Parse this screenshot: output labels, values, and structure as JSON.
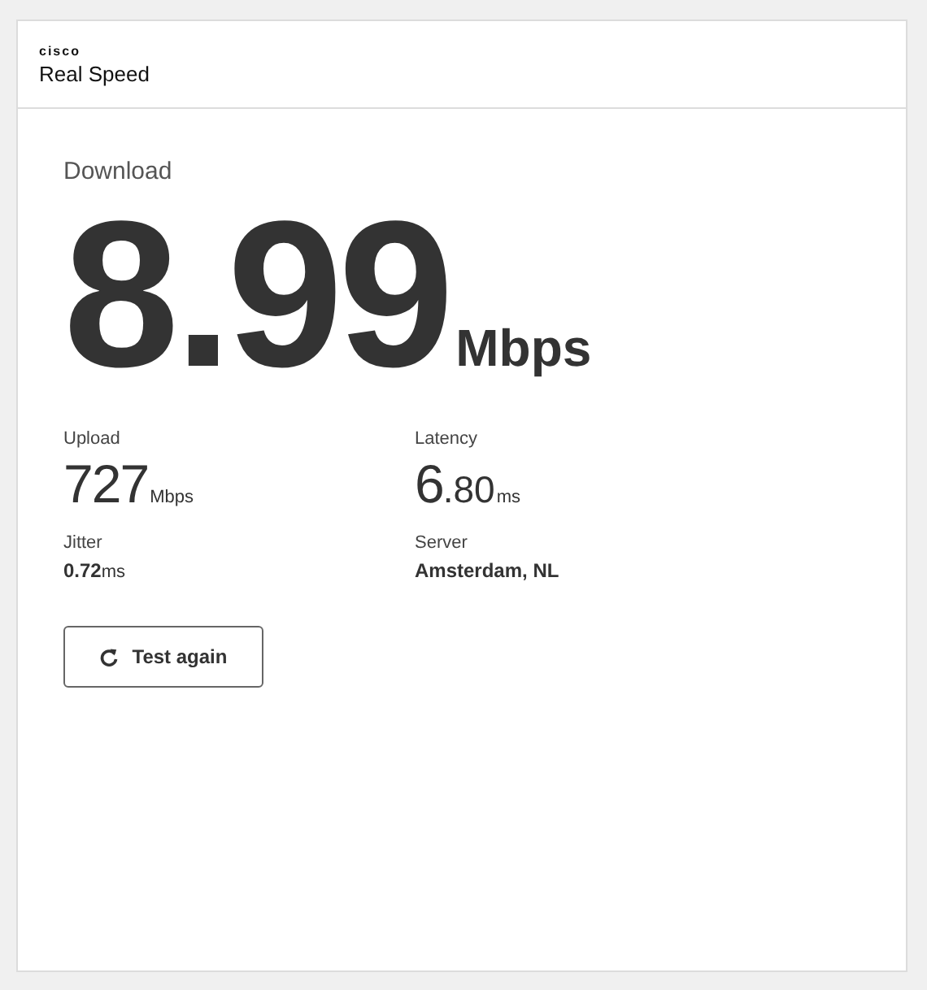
{
  "header": {
    "logo": "cisco",
    "title": "Real Speed"
  },
  "download": {
    "label": "Download",
    "value": "8.99",
    "unit": "Mbps"
  },
  "metrics": [
    {
      "kind": "large",
      "label": "Upload",
      "value": "727",
      "unit": "Mbps"
    },
    {
      "kind": "large",
      "label": "Latency",
      "value": "6",
      "fraction": ".80",
      "unit": "ms"
    },
    {
      "kind": "small",
      "label": "Jitter",
      "value": "0.72",
      "unit": "ms"
    },
    {
      "kind": "text",
      "label": "Server",
      "value": "Amsterdam, NL"
    }
  ],
  "button": {
    "label": "Test again"
  }
}
